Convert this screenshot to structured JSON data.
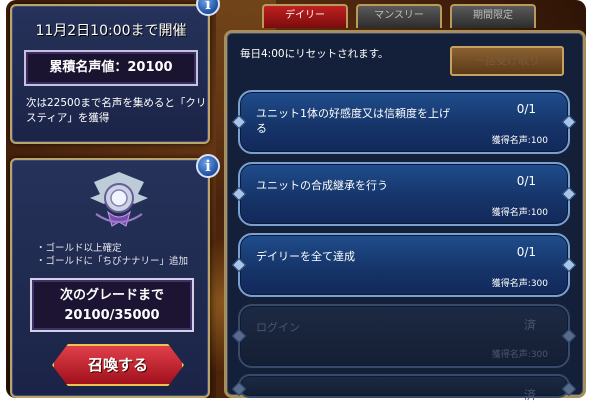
{
  "event": {
    "deadline_text": "11月2日10:00まで開催",
    "fame_total_text": "累積名声値：20100",
    "reward_note": "次は22500まで名声を集めると「クリスティア」を獲得"
  },
  "summon": {
    "grade_lines": [
      "・ゴールド以上確定",
      "・ゴールドに「ちびナナリー」追加"
    ],
    "next_grade_label": "次のグレードまで",
    "next_grade_value": "20100/35000",
    "button_label": "召喚する"
  },
  "info_icon": "i",
  "tabs": [
    {
      "label": "デイリー",
      "active": true
    },
    {
      "label": "マンスリー",
      "active": false
    },
    {
      "label": "期間限定",
      "active": false
    }
  ],
  "board": {
    "reset_note": "毎日4:00にリセットされます。",
    "claim_all_label": "一括受け取り"
  },
  "missions": [
    {
      "title": "ユニット1体の好感度又は信頼度を上げる",
      "progress": "0/1",
      "reward": "獲得名声:100"
    },
    {
      "title": "ユニットの合成継承を行う",
      "progress": "0/1",
      "reward": "獲得名声:100"
    },
    {
      "title": "デイリーを全て達成",
      "progress": "0/1",
      "reward": "獲得名声:300"
    },
    {
      "title": "ログイン",
      "progress": "済",
      "reward": "獲得名声:300"
    },
    {
      "title": "",
      "progress": "済",
      "reward": ""
    }
  ],
  "colors": {
    "panel_bg": "#26325a",
    "mission_active": "#1f4d8c",
    "mission_done": "#1d2a44",
    "tab_active": "#c02020",
    "summon_button": "#e0404a",
    "gold_border": "#b9a46a"
  }
}
